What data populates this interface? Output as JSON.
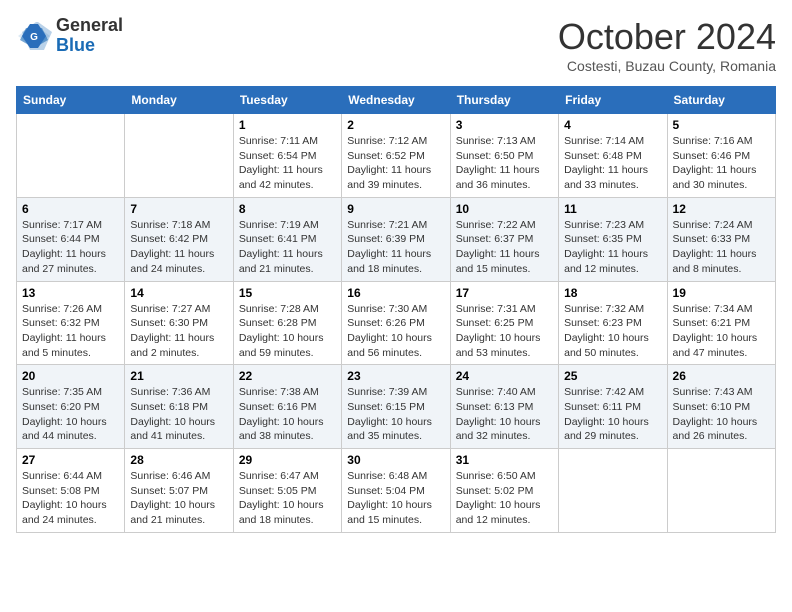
{
  "header": {
    "logo_general": "General",
    "logo_blue": "Blue",
    "month_title": "October 2024",
    "subtitle": "Costesti, Buzau County, Romania"
  },
  "days_of_week": [
    "Sunday",
    "Monday",
    "Tuesday",
    "Wednesday",
    "Thursday",
    "Friday",
    "Saturday"
  ],
  "weeks": [
    [
      {
        "day": "",
        "info": ""
      },
      {
        "day": "",
        "info": ""
      },
      {
        "day": "1",
        "info": "Sunrise: 7:11 AM\nSunset: 6:54 PM\nDaylight: 11 hours and 42 minutes."
      },
      {
        "day": "2",
        "info": "Sunrise: 7:12 AM\nSunset: 6:52 PM\nDaylight: 11 hours and 39 minutes."
      },
      {
        "day": "3",
        "info": "Sunrise: 7:13 AM\nSunset: 6:50 PM\nDaylight: 11 hours and 36 minutes."
      },
      {
        "day": "4",
        "info": "Sunrise: 7:14 AM\nSunset: 6:48 PM\nDaylight: 11 hours and 33 minutes."
      },
      {
        "day": "5",
        "info": "Sunrise: 7:16 AM\nSunset: 6:46 PM\nDaylight: 11 hours and 30 minutes."
      }
    ],
    [
      {
        "day": "6",
        "info": "Sunrise: 7:17 AM\nSunset: 6:44 PM\nDaylight: 11 hours and 27 minutes."
      },
      {
        "day": "7",
        "info": "Sunrise: 7:18 AM\nSunset: 6:42 PM\nDaylight: 11 hours and 24 minutes."
      },
      {
        "day": "8",
        "info": "Sunrise: 7:19 AM\nSunset: 6:41 PM\nDaylight: 11 hours and 21 minutes."
      },
      {
        "day": "9",
        "info": "Sunrise: 7:21 AM\nSunset: 6:39 PM\nDaylight: 11 hours and 18 minutes."
      },
      {
        "day": "10",
        "info": "Sunrise: 7:22 AM\nSunset: 6:37 PM\nDaylight: 11 hours and 15 minutes."
      },
      {
        "day": "11",
        "info": "Sunrise: 7:23 AM\nSunset: 6:35 PM\nDaylight: 11 hours and 12 minutes."
      },
      {
        "day": "12",
        "info": "Sunrise: 7:24 AM\nSunset: 6:33 PM\nDaylight: 11 hours and 8 minutes."
      }
    ],
    [
      {
        "day": "13",
        "info": "Sunrise: 7:26 AM\nSunset: 6:32 PM\nDaylight: 11 hours and 5 minutes."
      },
      {
        "day": "14",
        "info": "Sunrise: 7:27 AM\nSunset: 6:30 PM\nDaylight: 11 hours and 2 minutes."
      },
      {
        "day": "15",
        "info": "Sunrise: 7:28 AM\nSunset: 6:28 PM\nDaylight: 10 hours and 59 minutes."
      },
      {
        "day": "16",
        "info": "Sunrise: 7:30 AM\nSunset: 6:26 PM\nDaylight: 10 hours and 56 minutes."
      },
      {
        "day": "17",
        "info": "Sunrise: 7:31 AM\nSunset: 6:25 PM\nDaylight: 10 hours and 53 minutes."
      },
      {
        "day": "18",
        "info": "Sunrise: 7:32 AM\nSunset: 6:23 PM\nDaylight: 10 hours and 50 minutes."
      },
      {
        "day": "19",
        "info": "Sunrise: 7:34 AM\nSunset: 6:21 PM\nDaylight: 10 hours and 47 minutes."
      }
    ],
    [
      {
        "day": "20",
        "info": "Sunrise: 7:35 AM\nSunset: 6:20 PM\nDaylight: 10 hours and 44 minutes."
      },
      {
        "day": "21",
        "info": "Sunrise: 7:36 AM\nSunset: 6:18 PM\nDaylight: 10 hours and 41 minutes."
      },
      {
        "day": "22",
        "info": "Sunrise: 7:38 AM\nSunset: 6:16 PM\nDaylight: 10 hours and 38 minutes."
      },
      {
        "day": "23",
        "info": "Sunrise: 7:39 AM\nSunset: 6:15 PM\nDaylight: 10 hours and 35 minutes."
      },
      {
        "day": "24",
        "info": "Sunrise: 7:40 AM\nSunset: 6:13 PM\nDaylight: 10 hours and 32 minutes."
      },
      {
        "day": "25",
        "info": "Sunrise: 7:42 AM\nSunset: 6:11 PM\nDaylight: 10 hours and 29 minutes."
      },
      {
        "day": "26",
        "info": "Sunrise: 7:43 AM\nSunset: 6:10 PM\nDaylight: 10 hours and 26 minutes."
      }
    ],
    [
      {
        "day": "27",
        "info": "Sunrise: 6:44 AM\nSunset: 5:08 PM\nDaylight: 10 hours and 24 minutes."
      },
      {
        "day": "28",
        "info": "Sunrise: 6:46 AM\nSunset: 5:07 PM\nDaylight: 10 hours and 21 minutes."
      },
      {
        "day": "29",
        "info": "Sunrise: 6:47 AM\nSunset: 5:05 PM\nDaylight: 10 hours and 18 minutes."
      },
      {
        "day": "30",
        "info": "Sunrise: 6:48 AM\nSunset: 5:04 PM\nDaylight: 10 hours and 15 minutes."
      },
      {
        "day": "31",
        "info": "Sunrise: 6:50 AM\nSunset: 5:02 PM\nDaylight: 10 hours and 12 minutes."
      },
      {
        "day": "",
        "info": ""
      },
      {
        "day": "",
        "info": ""
      }
    ]
  ]
}
